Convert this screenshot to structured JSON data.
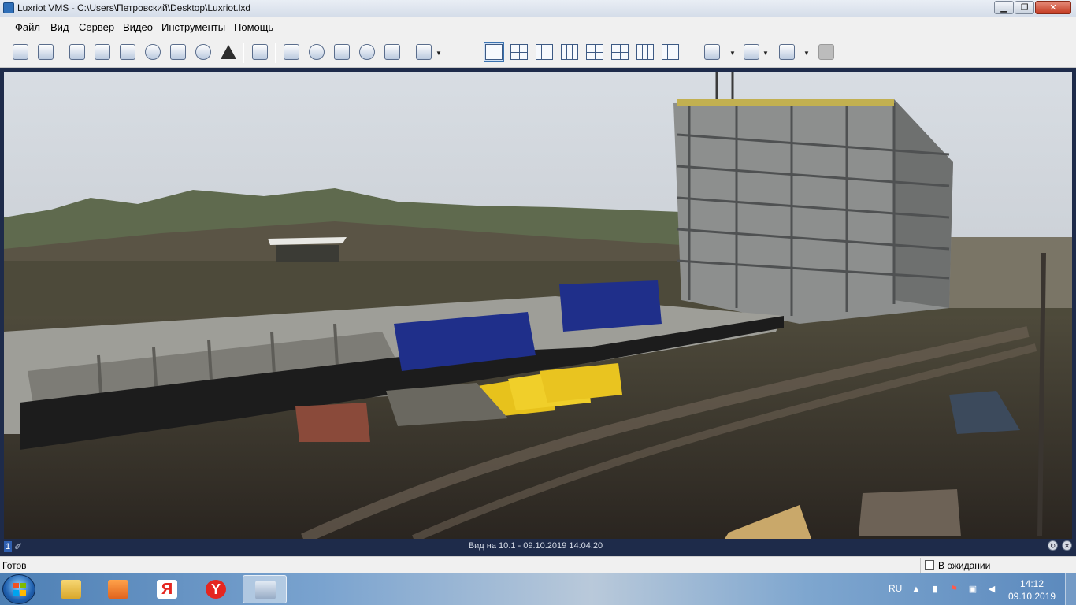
{
  "window": {
    "title": "Luxriot VMS - C:\\Users\\Петровский\\Desktop\\Luxriot.lxd",
    "minimize_label": "▁",
    "maximize_label": "❐",
    "close_label": "✕"
  },
  "menu": {
    "file": "Файл",
    "view": "Вид",
    "server": "Сервер",
    "video": "Видео",
    "tools": "Инструменты",
    "help": "Помощь"
  },
  "video": {
    "camera_number": "1",
    "view_info": "Вид на 10.1 - 09.10.2019 14:04:20"
  },
  "statusbar": {
    "ready": "Готов",
    "waiting": "В ожидании"
  },
  "taskbar": {
    "language": "RU",
    "time": "14:12",
    "date": "09.10.2019",
    "yandex_letter": "Я",
    "yandex_browser_letter": "Y"
  },
  "colors": {
    "app_background": "#1e2b4a",
    "toolbar_background": "#f0f0f0",
    "selected_tool_border": "#3a72b0"
  }
}
